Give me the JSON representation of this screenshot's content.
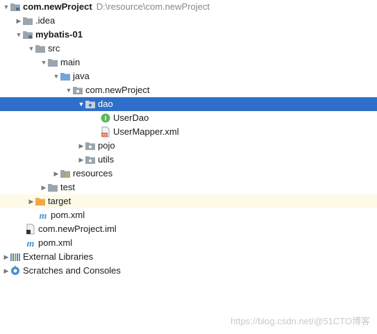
{
  "tree": {
    "root": {
      "name": "com.newProject",
      "path": "D:\\resource\\com.newProject"
    },
    "idea": {
      "name": ".idea"
    },
    "module": {
      "name": "mybatis-01"
    },
    "src": {
      "name": "src"
    },
    "main": {
      "name": "main"
    },
    "java": {
      "name": "java"
    },
    "package": {
      "name": "com.newProject"
    },
    "dao": {
      "name": "dao"
    },
    "user_dao": {
      "name": "UserDao"
    },
    "user_mapper": {
      "name": "UserMapper.xml"
    },
    "pojo": {
      "name": "pojo"
    },
    "utils": {
      "name": "utils"
    },
    "resources": {
      "name": "resources"
    },
    "test": {
      "name": "test"
    },
    "target": {
      "name": "target"
    },
    "module_pom": {
      "name": "pom.xml"
    },
    "iml": {
      "name": "com.newProject.iml"
    },
    "root_pom": {
      "name": "pom.xml"
    },
    "external_libraries": {
      "name": "External Libraries"
    },
    "scratches": {
      "name": "Scratches and Consoles"
    }
  },
  "colors": {
    "selection": "#2f6fcb",
    "folder": "#9aa5ad",
    "source_folder": "#6ea7d8",
    "excluded_folder": "#f0a849",
    "interface_icon": "#5fb85c",
    "maven": "#4a90d0"
  },
  "watermark": "https://blog.csdn.net/@51CTO博客"
}
